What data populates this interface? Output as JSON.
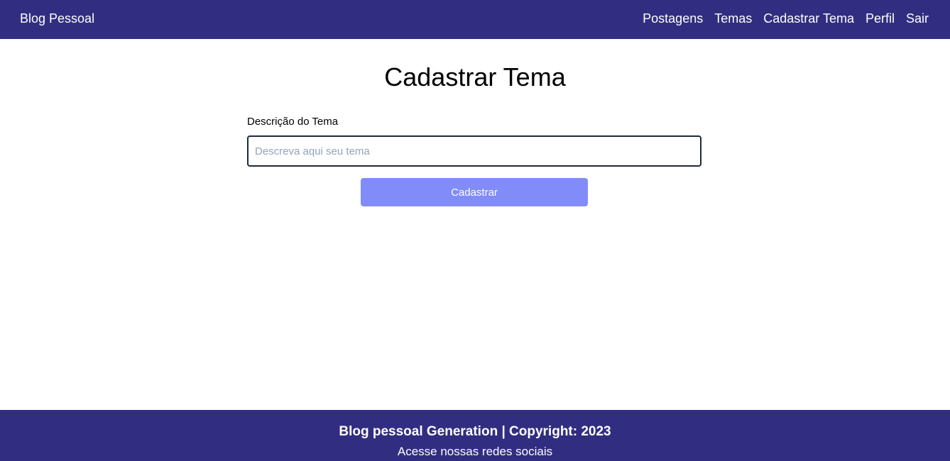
{
  "navbar": {
    "brand": "Blog Pessoal",
    "links": [
      "Postagens",
      "Temas",
      "Cadastrar Tema",
      "Perfil",
      "Sair"
    ]
  },
  "main": {
    "title": "Cadastrar Tema",
    "field_label": "Descrição do Tema",
    "input_value": "",
    "input_placeholder": "Descreva aqui seu tema",
    "submit_label": "Cadastrar"
  },
  "footer": {
    "title": "Blog pessoal Generation | Copyright: 2023",
    "subtitle": "Acesse nossas redes sociais"
  },
  "colors": {
    "navbar_bg": "#312e81",
    "button_bg": "#818cf8",
    "input_border": "#1e293b"
  }
}
